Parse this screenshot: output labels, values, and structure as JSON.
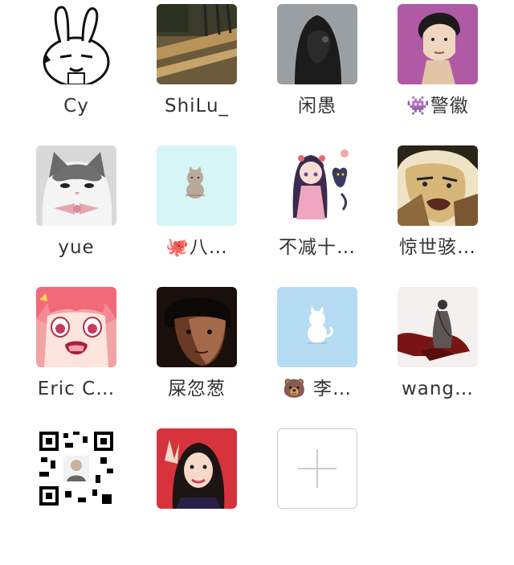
{
  "members": [
    {
      "name": "Cy"
    },
    {
      "name": "ShiLu_"
    },
    {
      "name": "闲愚"
    },
    {
      "name": "👾警徽"
    },
    {
      "name": "yue"
    },
    {
      "name": "🐙八…"
    },
    {
      "name": "不减十…"
    },
    {
      "name": "惊世骇…"
    },
    {
      "name": "Eric C…"
    },
    {
      "name": "屎忽葱"
    },
    {
      "name": "🐻 李…"
    },
    {
      "name": "wang…"
    },
    {
      "name": ""
    },
    {
      "name": ""
    }
  ],
  "add_member": {
    "icon": "plus-icon"
  },
  "colors": {
    "text": "#333333",
    "add_border": "#cfcfcf",
    "plus": "#cccccc"
  }
}
